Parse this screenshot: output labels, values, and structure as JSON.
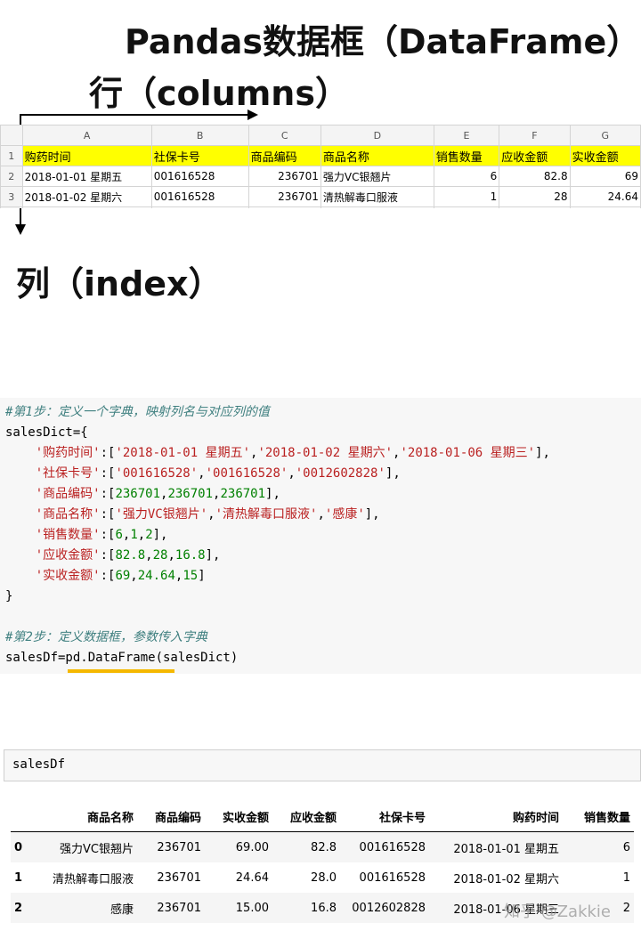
{
  "titles": {
    "main": "Pandas数据框（DataFrame）",
    "columns": "行（columns）",
    "index": "列（index）"
  },
  "excel": {
    "col_letters": [
      "A",
      "B",
      "C",
      "D",
      "E",
      "F",
      "G"
    ],
    "header_row_num": "1",
    "headers": [
      "购药时间",
      "社保卡号",
      "商品编码",
      "商品名称",
      "销售数量",
      "应收金额",
      "实收金额"
    ],
    "rows": [
      {
        "num": "2",
        "cells": [
          "2018-01-01 星期五",
          "001616528",
          "236701",
          "强力VC银翘片",
          "6",
          "82.8",
          "69"
        ]
      },
      {
        "num": "3",
        "cells": [
          "2018-01-02 星期六",
          "001616528",
          "236701",
          "清热解毒口服液",
          "1",
          "28",
          "24.64"
        ]
      }
    ]
  },
  "code": {
    "comment1": "#第1步：定义一个字典，映射列名与对应列的值",
    "dict_open": "salesDict={",
    "lines": [
      {
        "key": "'购药时间'",
        "sep": ":[",
        "vals": [
          "'2018-01-01 星期五'",
          "'2018-01-02 星期六'",
          "'2018-01-06 星期三'"
        ],
        "end": "],",
        "type": "str"
      },
      {
        "key": "'社保卡号'",
        "sep": ":[",
        "vals": [
          "'001616528'",
          "'001616528'",
          "'0012602828'"
        ],
        "end": "],",
        "type": "str"
      },
      {
        "key": "'商品编码'",
        "sep": ":[",
        "vals": [
          "236701",
          "236701",
          "236701"
        ],
        "end": "],",
        "type": "num"
      },
      {
        "key": "'商品名称'",
        "sep": ":[",
        "vals": [
          "'强力VC银翘片'",
          "'清热解毒口服液'",
          "'感康'"
        ],
        "end": "],",
        "type": "str"
      },
      {
        "key": "'销售数量'",
        "sep": ":[",
        "vals": [
          "6",
          "1",
          "2"
        ],
        "end": "],",
        "type": "num"
      },
      {
        "key": "'应收金额'",
        "sep": ":[",
        "vals": [
          "82.8",
          "28",
          "16.8"
        ],
        "end": "],",
        "type": "num"
      },
      {
        "key": "'实收金额'",
        "sep": ":[",
        "vals": [
          "69",
          "24.64",
          "15"
        ],
        "end": "]",
        "type": "num"
      }
    ],
    "dict_close": "}",
    "comment2": "#第2步：定义数据框，参数传入字典",
    "stmt": "salesDf=pd.DataFrame(salesDict)"
  },
  "input_cell": {
    "text": "salesDf"
  },
  "dataframe": {
    "columns": [
      "",
      "商品名称",
      "商品编码",
      "实收金额",
      "应收金额",
      "社保卡号",
      "购药时间",
      "销售数量"
    ],
    "rows": [
      [
        "0",
        "强力VC银翘片",
        "236701",
        "69.00",
        "82.8",
        "001616528",
        "2018-01-01 星期五",
        "6"
      ],
      [
        "1",
        "清热解毒口服液",
        "236701",
        "24.64",
        "28.0",
        "001616528",
        "2018-01-02 星期六",
        "1"
      ],
      [
        "2",
        "感康",
        "236701",
        "15.00",
        "16.8",
        "0012602828",
        "2018-01-06 星期三",
        "2"
      ]
    ]
  },
  "watermark": "知乎 @Zakkie",
  "colors": {
    "header_yellow": "#ffff00",
    "underline": "#f5b800",
    "comment": "#408080",
    "string": "#ba2121",
    "number": "#008000"
  }
}
